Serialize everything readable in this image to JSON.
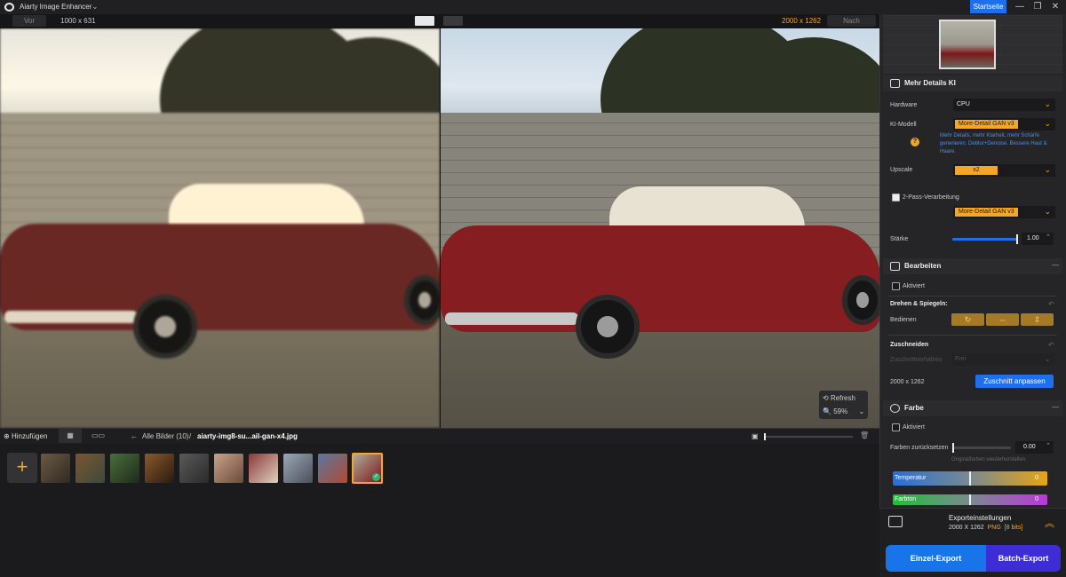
{
  "app": {
    "title": "Aiarty Image Enhancer",
    "home_button": "Startseite"
  },
  "infobar": {
    "before_label": "Vor",
    "before_size": "1000 x 631",
    "after_size": "2000 x 1262",
    "after_label": "Nach"
  },
  "viewer": {
    "refresh_label": "Refresh",
    "zoom_value": "59%"
  },
  "toolbar": {
    "add_label": "Hinzufügen",
    "breadcrumb_all": "Alle Bilder (10)",
    "breadcrumb_sep": "/",
    "current_file": "aiarty-img8-su...ail-gan-x4.jpg"
  },
  "thumbnails": {
    "count": 10,
    "selected_index": 9
  },
  "panel": {
    "detail_section": {
      "title": "Mehr Details KI",
      "hardware_label": "Hardware",
      "hardware_value": "CPU",
      "model_label": "KI-Modell",
      "model_value": "More-Detail GAN  v3",
      "model_desc": "Mehr Details, mehr Klarheit, mehr Schärfe generieren. Deblur+Denoise. Bessere Haut & Haare.",
      "upscale_label": "Upscale",
      "upscale_value": "x2",
      "twopass_label": "2-Pass-Verarbeitung",
      "twopass_checked": true,
      "twopass_model": "More-Detail GAN  v3",
      "strength_label": "Stärke",
      "strength_value": "1.00",
      "strength_fraction": 1.0
    },
    "edit_section": {
      "title": "Bearbeiten",
      "enabled_label": "Aktiviert",
      "rotate_title": "Drehen & Spiegeln:",
      "rotate_label": "Bedienen",
      "crop_title": "Zuschneiden",
      "crop_ratio_label": "Zuschnittverhältnis",
      "crop_ratio_value": "Frei",
      "crop_size": "2000 x 1262",
      "crop_button": "Zuschnitt anpassen"
    },
    "color_section": {
      "title": "Farbe",
      "enabled_label": "Aktiviert",
      "reset_label": "Farben zurücksetzen",
      "reset_value": "0.00",
      "reset_hint": "Originalfarben wiederherstellen.",
      "temperature_label": "Temperatur",
      "temperature_value": "0",
      "hue_label": "Farbton",
      "hue_value": "0"
    },
    "export": {
      "title": "Exporteinstellungen",
      "size": "2000 X 1262",
      "format": "PNG",
      "bits": "[8 bits]",
      "single_button": "Einzel-Export",
      "batch_button": "Batch-Export"
    }
  },
  "colors": {
    "accent": "#f5a623",
    "primary_blue": "#1874e8",
    "batch_purple": "#3d2dd6"
  }
}
